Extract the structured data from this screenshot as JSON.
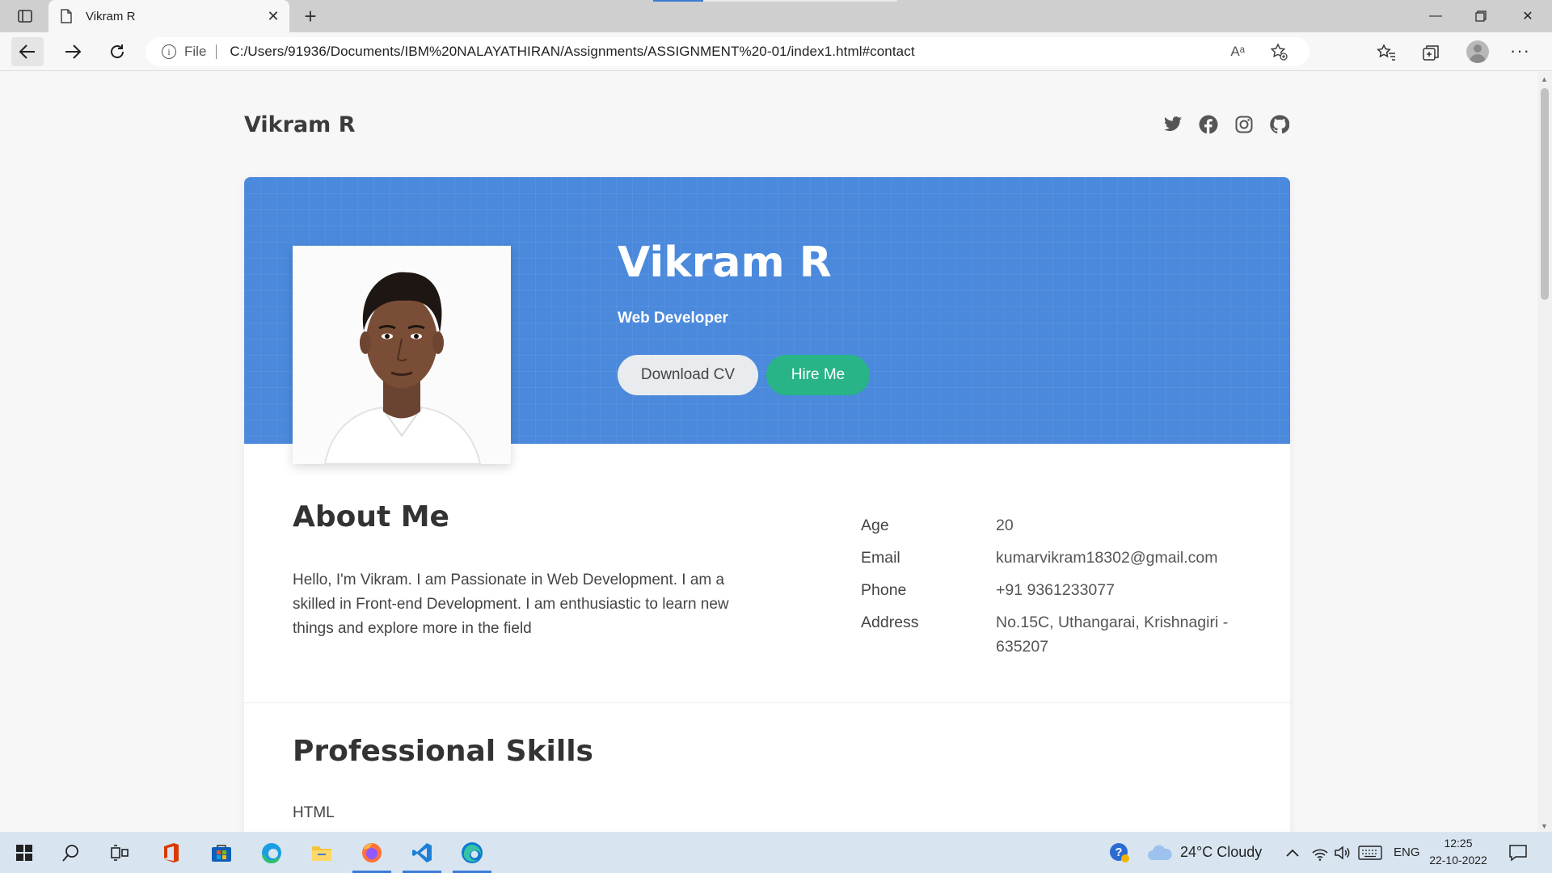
{
  "browser": {
    "tab_title": "Vikram R",
    "scheme": "File",
    "url": "C:/Users/91936/Documents/IBM%20NALAYATHIRAN/Assignments/ASSIGNMENT%20-01/index1.html#contact",
    "read_aloud": "Aᵃ"
  },
  "site": {
    "brand": "Vikram R",
    "socials": [
      "twitter-icon",
      "facebook-icon",
      "instagram-icon",
      "github-icon"
    ]
  },
  "hero": {
    "name": "Vikram R",
    "role": "Web Developer",
    "download_cv": "Download CV",
    "hire_me": "Hire Me",
    "colors": {
      "banner": "#4a89dc",
      "hire": "#28b487",
      "cv": "#e9ecef"
    }
  },
  "about": {
    "title": "About Me",
    "text": "Hello, I'm Vikram. I am Passionate in Web Development. I am a skilled in Front-end Development. I am enthusiastic to learn new things and explore more in the field",
    "info": [
      {
        "label": "Age",
        "value": "20"
      },
      {
        "label": "Email",
        "value": "kumarvikram18302@gmail.com"
      },
      {
        "label": "Phone",
        "value": "+91 9361233077"
      },
      {
        "label": "Address",
        "value": "No.15C, Uthangarai, Krishnagiri - 635207"
      }
    ]
  },
  "skills": {
    "title": "Professional Skills",
    "first_skill": "HTML"
  },
  "taskbar": {
    "weather": "24°C  Cloudy",
    "language": "ENG",
    "time": "12:25",
    "date": "22-10-2022"
  }
}
